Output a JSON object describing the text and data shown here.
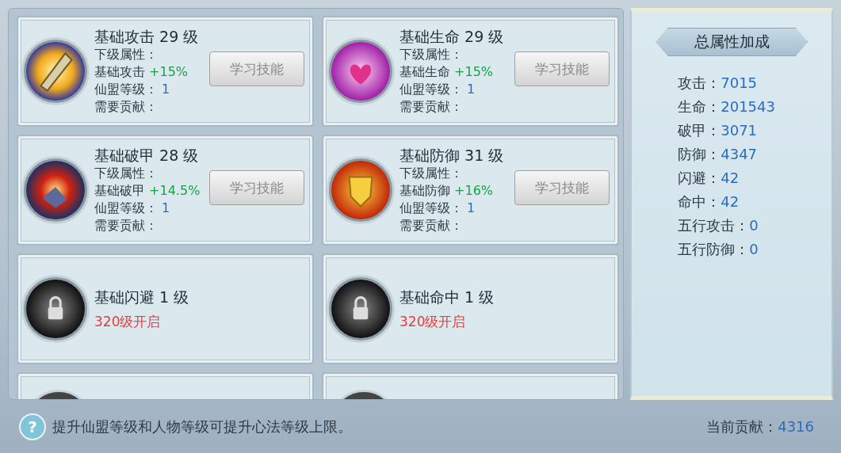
{
  "skills": [
    {
      "kind": "unlocked",
      "title": "基础攻击 29 级",
      "next_label": "下级属性：",
      "bonus_name": "基础攻击",
      "bonus_value": "+15%",
      "guild_label": "仙盟等级：",
      "guild_value": "1",
      "cost_label": "需要贡献：",
      "button": {
        "label": "学习技能",
        "disabled": true
      }
    },
    {
      "kind": "unlocked",
      "title": "基础生命 29 级",
      "next_label": "下级属性：",
      "bonus_name": "基础生命",
      "bonus_value": "+15%",
      "guild_label": "仙盟等级：",
      "guild_value": "1",
      "cost_label": "需要贡献：",
      "button": {
        "label": "学习技能",
        "disabled": true
      }
    },
    {
      "kind": "unlocked",
      "title": "基础破甲 28 级",
      "next_label": "下级属性：",
      "bonus_name": "基础破甲",
      "bonus_value": "+14.5%",
      "guild_label": "仙盟等级：",
      "guild_value": "1",
      "cost_label": "需要贡献：",
      "button": {
        "label": "学习技能",
        "disabled": true
      }
    },
    {
      "kind": "unlocked",
      "title": "基础防御 31 级",
      "next_label": "下级属性：",
      "bonus_name": "基础防御",
      "bonus_value": "+16%",
      "guild_label": "仙盟等级：",
      "guild_value": "1",
      "cost_label": "需要贡献：",
      "button": {
        "label": "学习技能",
        "disabled": true
      }
    },
    {
      "kind": "locked",
      "title": "基础闪避 1 级",
      "requirement": "320级开启"
    },
    {
      "kind": "locked",
      "title": "基础命中 1 级",
      "requirement": "320级开启"
    },
    {
      "kind": "cut"
    },
    {
      "kind": "cut"
    }
  ],
  "summary": {
    "title": "总属性加成",
    "stats": [
      {
        "label": "攻击：",
        "value": "7015"
      },
      {
        "label": "生命：",
        "value": "201543"
      },
      {
        "label": "破甲：",
        "value": "3071"
      },
      {
        "label": "防御：",
        "value": "4347"
      },
      {
        "label": "闪避：",
        "value": "42"
      },
      {
        "label": "命中：",
        "value": "42"
      },
      {
        "label": "五行攻击：",
        "value": "0"
      },
      {
        "label": "五行防御：",
        "value": "0"
      }
    ]
  },
  "footer": {
    "help": "?",
    "tip": "提升仙盟等级和人物等级可提升心法等级上限。",
    "contribution_label": "当前贡献：",
    "contribution_value": "4316"
  }
}
